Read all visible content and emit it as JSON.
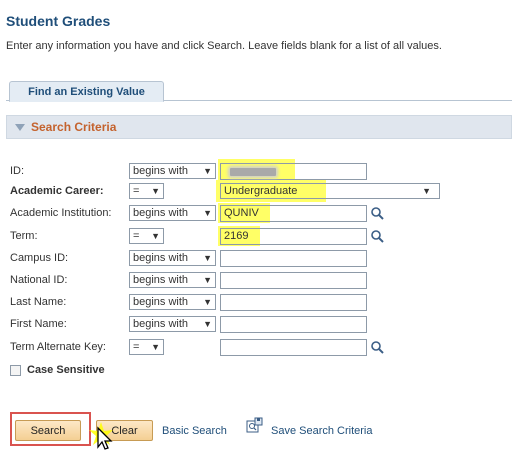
{
  "page": {
    "title": "Student Grades",
    "instructions": "Enter any information you have and click Search. Leave fields blank for a list of all values."
  },
  "tabs": [
    {
      "label": "Find an Existing Value"
    }
  ],
  "section": {
    "title": "Search Criteria"
  },
  "fields": [
    {
      "label": "ID:",
      "operator": "begins with",
      "value": "",
      "masked": true
    },
    {
      "label": "Academic Career:",
      "operator": "=",
      "value": "Undergraduate"
    },
    {
      "label": "Academic Institution:",
      "operator": "begins with",
      "value": "QUNIV"
    },
    {
      "label": "Term:",
      "operator": "=",
      "value": "2169"
    },
    {
      "label": "Campus ID:",
      "operator": "begins with",
      "value": ""
    },
    {
      "label": "National ID:",
      "operator": "begins with",
      "value": ""
    },
    {
      "label": "Last Name:",
      "operator": "begins with",
      "value": ""
    },
    {
      "label": "First Name:",
      "operator": "begins with",
      "value": ""
    },
    {
      "label": "Term Alternate Key:",
      "operator": "=",
      "value": ""
    }
  ],
  "case_sensitive": {
    "label": "Case Sensitive",
    "checked": false
  },
  "actions": {
    "search": "Search",
    "clear": "Clear",
    "basic_search": "Basic Search",
    "save_search": "Save Search Criteria"
  },
  "colors": {
    "title": "#1f4e79",
    "section_title": "#c4622d",
    "highlight": "#ffff66",
    "button_bg": "#f4cf93",
    "callout_border": "#d9534f"
  },
  "icons": {
    "lookup": "magnifier-icon",
    "dropdown": "chevron-down-icon",
    "collapse": "triangle-down-icon",
    "save": "save-search-icon",
    "cursor": "mouse-pointer-icon"
  }
}
